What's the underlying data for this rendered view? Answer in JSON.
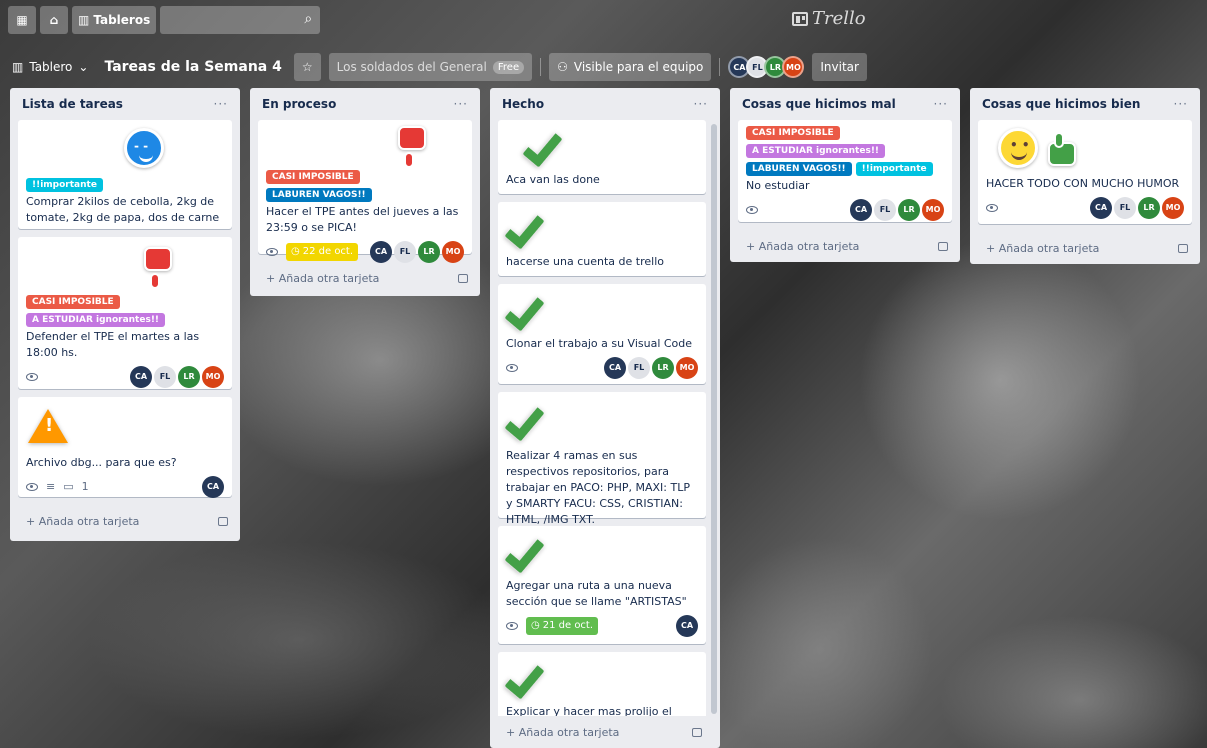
{
  "nav": {
    "boards_label": "Tableros",
    "search_placeholder": "",
    "logo_text": "Trello"
  },
  "header": {
    "view_label": "Tablero",
    "board_title": "Tareas de la Semana 4",
    "team_name": "Los soldados del General",
    "team_badge": "Free",
    "visibility_label": "Visible para el equipo",
    "invite_label": "Invitar",
    "members": [
      "CA",
      "FL",
      "LR",
      "MO"
    ]
  },
  "add_card_label": "+ Añada otra tarjeta",
  "lists": [
    {
      "title": "Lista de tareas",
      "cards": [
        {
          "sticker": "blue-wink-face",
          "labels": [
            "!!importante"
          ],
          "text": "Comprar 2kilos de cebolla, 2kg de tomate, 2kg de papa, dos de carne"
        },
        {
          "sticker": "thumbs-down",
          "labels": [
            "CASI IMPOSIBLE",
            "A ESTUDIAR ignorantes!!"
          ],
          "text": "Defender el TPE el martes a las 18:00 hs.",
          "members": [
            "CA",
            "FL",
            "LR",
            "MO"
          ]
        },
        {
          "sticker": "warning",
          "text": "Archivo dbg... para que es?",
          "comments": "1",
          "members": [
            "CA"
          ]
        }
      ]
    },
    {
      "title": "En proceso",
      "cards": [
        {
          "sticker": "thumbs-down",
          "labels": [
            "CASI IMPOSIBLE",
            "LABUREN VAGOS!!"
          ],
          "text": "Hacer el TPE antes del jueves a las 23:59 o se PICA!",
          "due": "22 de oct.",
          "members": [
            "CA",
            "FL",
            "LR",
            "MO"
          ]
        }
      ]
    },
    {
      "title": "Hecho",
      "cards": [
        {
          "sticker": "check",
          "text": "Aca van las done"
        },
        {
          "sticker": "check",
          "text": "hacerse una cuenta de trello"
        },
        {
          "sticker": "check",
          "text": "Clonar el trabajo a su Visual Code",
          "members": [
            "CA",
            "FL",
            "LR",
            "MO"
          ]
        },
        {
          "sticker": "check",
          "text": "Realizar 4 ramas en sus respectivos repositorios, para trabajar en PACO: PHP, MAXI: TLP y SMARTY FACU: CSS, CRISTIAN: HTML, /IMG TXT."
        },
        {
          "sticker": "check",
          "text": "Agregar una ruta a una nueva sección que se llame \"ARTISTAS\"",
          "due": "21 de oct.",
          "members": [
            "CA"
          ]
        },
        {
          "sticker": "check",
          "text": "Explicar y hacer mas prolijo el"
        }
      ]
    },
    {
      "title": "Cosas que hicimos mal",
      "cards": [
        {
          "labels": [
            "CASI IMPOSIBLE",
            "A ESTUDIAR ignorantes!!",
            "LABUREN VAGOS!!",
            "!!importante"
          ],
          "text": "No estudiar",
          "members": [
            "CA",
            "FL",
            "LR",
            "MO"
          ]
        }
      ]
    },
    {
      "title": "Cosas que hicimos bien",
      "cards": [
        {
          "sticker": "smiley-and-thumbs-up",
          "text": "HACER TODO CON MUCHO HUMOR",
          "members": [
            "CA",
            "FL",
            "LR",
            "MO"
          ]
        }
      ]
    }
  ],
  "colors": {
    "label_red": "#eb5a46",
    "label_purple": "#c377e0",
    "label_blue": "#0079bf",
    "label_sky": "#00c2e0",
    "due_yellow": "#f2d600",
    "due_green": "#61bd4f",
    "list_bg": "#ebecf0"
  }
}
